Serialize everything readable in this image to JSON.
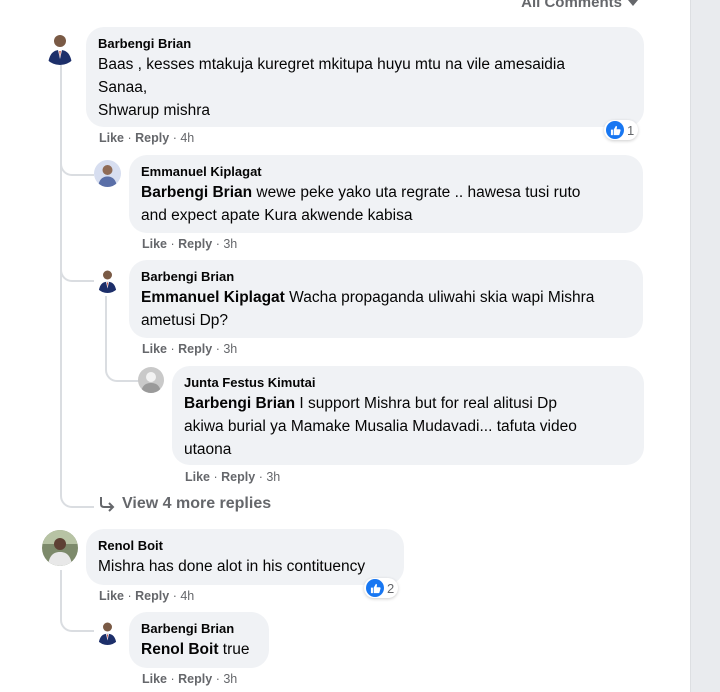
{
  "sort": {
    "label": "All Comments"
  },
  "c1": {
    "author": "Barbengi Brian",
    "line1": "Baas , kesses mtakuja kuregret mkitupa huyu mtu na vile amesaidia",
    "line2": "Sanaa,",
    "line3": "Shwarup mishra",
    "like": "Like",
    "reply": "Reply",
    "time": "4h",
    "reactions": "1"
  },
  "r1": {
    "author": "Emmanuel Kiplagat",
    "mention": "Barbengi Brian",
    "text1": " wewe peke yako uta regrate .. hawesa tusi ruto",
    "text2": "and expect apate Kura akwende kabisa",
    "like": "Like",
    "reply": "Reply",
    "time": "3h"
  },
  "r2": {
    "author": "Barbengi Brian",
    "mention": "Emmanuel Kiplagat",
    "text1": " Wacha propaganda uliwahi skia wapi Mishra",
    "text2": "ametusi Dp?",
    "like": "Like",
    "reply": "Reply",
    "time": "3h"
  },
  "r3": {
    "author": "Junta Festus Kimutai",
    "mention": "Barbengi Brian",
    "text1": " I support Mishra but for real alitusi Dp",
    "text2": "akiwa burial ya Mamake Musalia Mudavadi... tafuta video",
    "text3": "utaona",
    "like": "Like",
    "reply": "Reply",
    "time": "3h"
  },
  "view_more": {
    "label": "View 4 more replies"
  },
  "c2": {
    "author": "Renol Boit",
    "text": "Mishra has done alot in his contituency",
    "like": "Like",
    "reply": "Reply",
    "time": "4h",
    "reactions": "2"
  },
  "r4": {
    "author": "Barbengi Brian",
    "mention": "Renol Boit",
    "text": " true",
    "like": "Like",
    "reply": "Reply",
    "time": "3h"
  },
  "sep": "·"
}
